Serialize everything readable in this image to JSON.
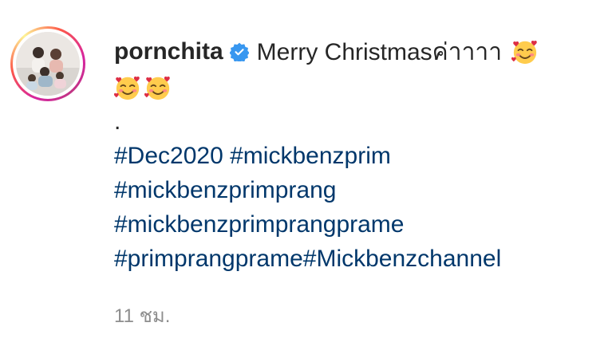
{
  "post": {
    "username": "pornchita",
    "verified_icon": "verified-badge-icon",
    "caption_text": "Merry Christmasค่าาาา",
    "emoji": "smiling-face-with-hearts",
    "separator": ".",
    "hashtags": {
      "line1": [
        "#Dec2020",
        "#mickbenzprim"
      ],
      "line2": [
        "#mickbenzprimprang"
      ],
      "line3": [
        "#mickbenzprimprangprame"
      ],
      "line4": [
        "#primprangprame",
        "#Mickbenzchannel"
      ]
    },
    "timestamp": "11 ชม."
  },
  "colors": {
    "text": "#262626",
    "hashtag": "#00376b",
    "muted": "#8e8e8e",
    "verified": "#3897f0"
  }
}
